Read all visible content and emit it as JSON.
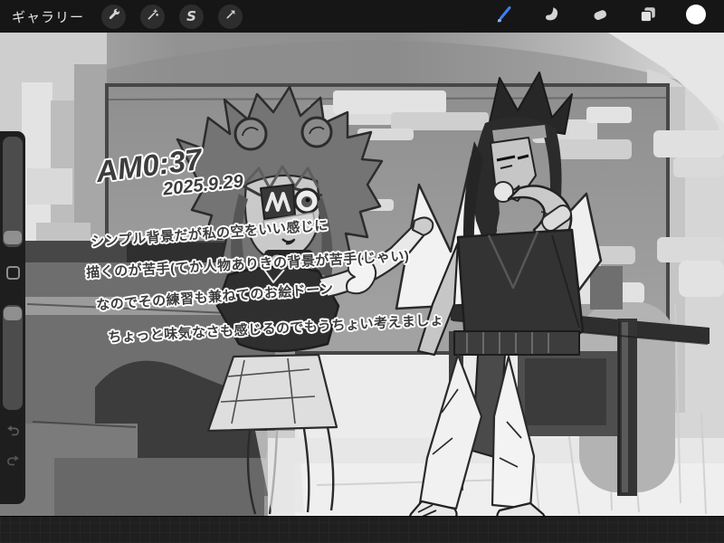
{
  "toolbar": {
    "gallery_label": "ギャラリー",
    "left_tools": [
      {
        "label": "actions",
        "icon": "wrench-icon"
      },
      {
        "label": "adjustments",
        "icon": "magic-wand-icon"
      },
      {
        "label": "selection",
        "icon": "selection-s-icon"
      },
      {
        "label": "transform",
        "icon": "transform-arrow-icon"
      }
    ],
    "right_tools": [
      {
        "label": "paint",
        "icon": "brush-icon",
        "active": true
      },
      {
        "label": "smudge",
        "icon": "smudge-icon",
        "active": false
      },
      {
        "label": "erase",
        "icon": "eraser-icon",
        "active": false
      },
      {
        "label": "layers",
        "icon": "layers-icon",
        "active": false
      },
      {
        "label": "color",
        "icon": "color-circle-icon",
        "active": false
      }
    ],
    "selection_glyph": "S",
    "active_tool_color": "#3d7ef5"
  },
  "sidebar": {
    "controls": [
      "brush-size-slider",
      "modify-button",
      "opacity-slider",
      "undo-button",
      "redo-button"
    ]
  },
  "artwork": {
    "time_note": "AM0:37",
    "date_note": "2025.9.29",
    "notes": [
      "シンプル背景だが私の空をいい感じに",
      "描くのが苦手(てか人物ありきの背景が苦手(じゃい)",
      "なのでその練習も兼ねてのお絵ドーン",
      "ちょっと味気なさも感じるのでもうちょい考えましょ"
    ]
  },
  "colors": {
    "topbar_bg": "#161616",
    "sidebar_bg": "#1e1e1e",
    "canvas_bg": "#ececec",
    "app_bg": "#1f1f1f",
    "accent": "#3d7ef5",
    "ink": "#2b2b2b"
  }
}
